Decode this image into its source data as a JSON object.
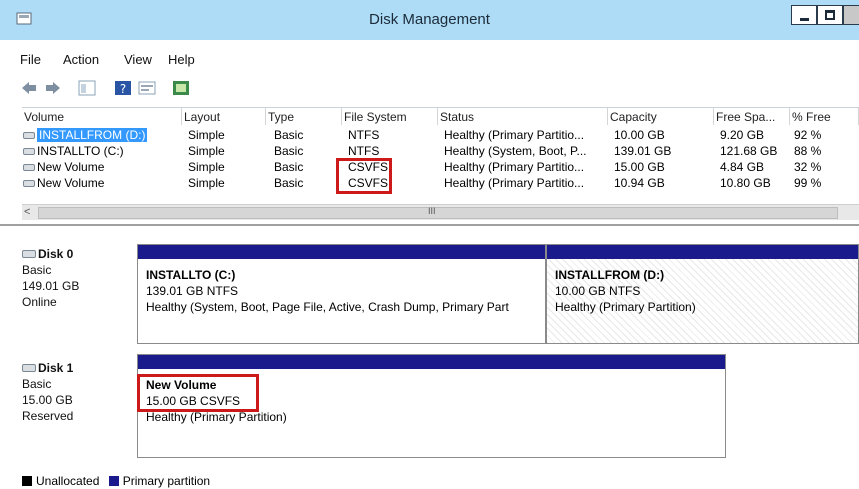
{
  "window": {
    "title": "Disk Management"
  },
  "menu": [
    "File",
    "Action",
    "View",
    "Help"
  ],
  "list": {
    "columns": [
      "Volume",
      "Layout",
      "Type",
      "File System",
      "Status",
      "Capacity",
      "Free Spa...",
      "% Free"
    ],
    "rows": [
      [
        "INSTALLFROM (D:)",
        "Simple",
        "Basic",
        "NTFS",
        "Healthy (Primary Partitio...",
        "10.00 GB",
        "9.20 GB",
        "92 %"
      ],
      [
        "INSTALLTO (C:)",
        "Simple",
        "Basic",
        "NTFS",
        "Healthy (System, Boot, P...",
        "139.01 GB",
        "121.68 GB",
        "88 %"
      ],
      [
        "New Volume",
        "Simple",
        "Basic",
        "CSVFS",
        "Healthy (Primary Partitio...",
        "15.00 GB",
        "4.84 GB",
        "32 %"
      ],
      [
        "New Volume",
        "Simple",
        "Basic",
        "CSVFS",
        "Healthy (Primary Partitio...",
        "10.94 GB",
        "10.80 GB",
        "99 %"
      ]
    ],
    "scroll_grip": "III",
    "scroll_left": "<"
  },
  "disks": [
    {
      "name": "Disk 0",
      "type": "Basic",
      "size": "149.01 GB",
      "state": "Online",
      "partitions": [
        {
          "name": "INSTALLTO (C:)",
          "size_fs": "139.01 GB NTFS",
          "status": "Healthy (System, Boot, Page File, Active, Crash Dump, Primary Part"
        },
        {
          "name": "INSTALLFROM (D:)",
          "size_fs": "10.00 GB NTFS",
          "status": "Healthy (Primary Partition)"
        }
      ]
    },
    {
      "name": "Disk 1",
      "type": "Basic",
      "size": "15.00 GB",
      "state": "Reserved",
      "partitions": [
        {
          "name": "New Volume",
          "size_fs": "15.00 GB CSVFS",
          "status": "Healthy (Primary Partition)"
        }
      ]
    }
  ],
  "legend": [
    {
      "label": "Unallocated",
      "color": "#000000"
    },
    {
      "label": "Primary partition",
      "color": "#1a1a8c"
    }
  ],
  "colors": {
    "highlight": "#cc1a1a",
    "partition_bar": "#1a1a8c",
    "selection": "#3399ff",
    "titlebar": "#aedcf6"
  }
}
